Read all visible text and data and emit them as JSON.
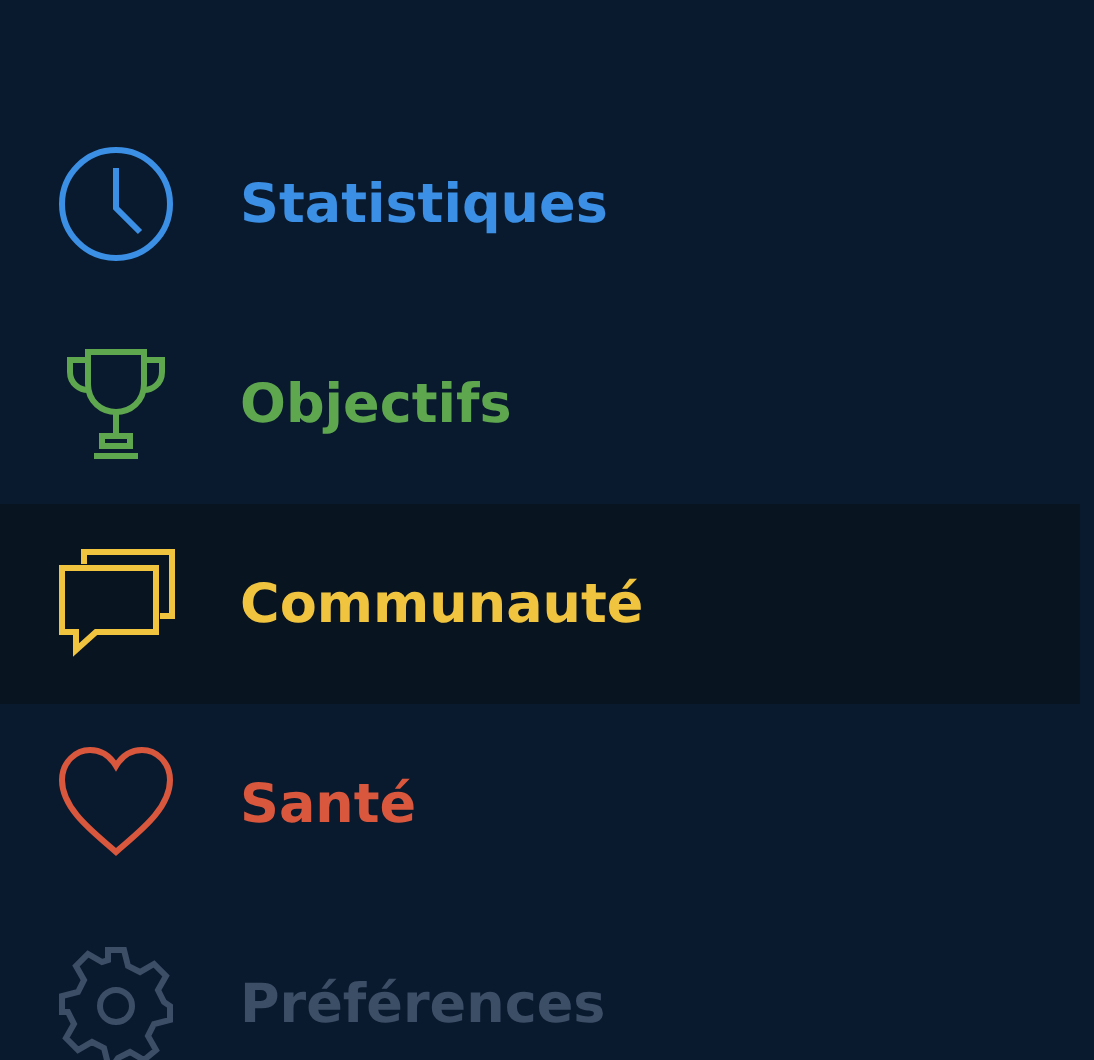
{
  "menu": [
    {
      "kind": "clock",
      "label": "Statistiques",
      "color": "#3b8fe4",
      "selected": false
    },
    {
      "kind": "trophy",
      "label": "Objectifs",
      "color": "#5ea74f",
      "selected": false
    },
    {
      "kind": "chat",
      "label": "Communauté",
      "color": "#f1c43f",
      "selected": true
    },
    {
      "kind": "heart",
      "label": "Santé",
      "color": "#d9573c",
      "selected": false
    },
    {
      "kind": "gear",
      "label": "Préférences",
      "color": "#3c4e66",
      "selected": false
    }
  ]
}
